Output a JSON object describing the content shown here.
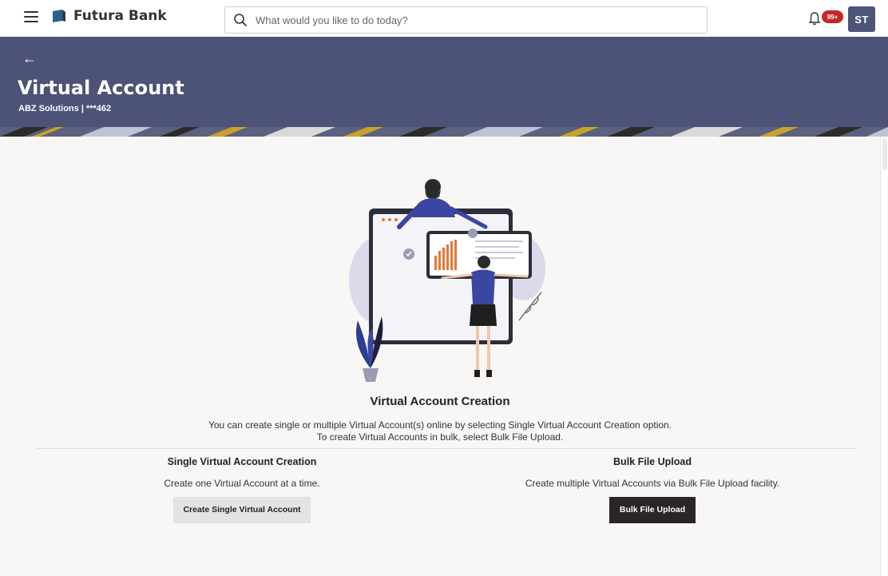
{
  "topbar": {
    "brand_name": "Futura Bank",
    "search_placeholder": "What would you like to do today?",
    "notification_count": "99+",
    "user_initials": "ST"
  },
  "header": {
    "back_arrow": "←",
    "title": "Virtual Account",
    "subtitle": "ABZ Solutions | ***462"
  },
  "content": {
    "section_title": "Virtual Account Creation",
    "description_line1": "You can create single or multiple Virtual Account(s) online by selecting Single Virtual Account Creation option.",
    "description_line2": "To create Virtual Accounts in bulk, select Bulk File Upload.",
    "single": {
      "title": "Single Virtual Account Creation",
      "description": "Create one Virtual Account at a time.",
      "button_label": "Create Single Virtual Account"
    },
    "bulk": {
      "title": "Bulk File Upload",
      "description": "Create multiple Virtual Accounts via Bulk File Upload facility.",
      "button_label": "Bulk File Upload"
    }
  },
  "colors": {
    "header_bg": "#4d5277",
    "avatar_bg": "#4d5478",
    "badge_bg": "#c62828",
    "primary_button_bg": "#2a2626",
    "secondary_button_bg": "#e4e3e1",
    "page_bg": "#f8f7f5"
  },
  "icons": [
    "hamburger-icon",
    "bank-logo-icon",
    "search-icon",
    "bell-icon",
    "back-arrow-icon"
  ]
}
